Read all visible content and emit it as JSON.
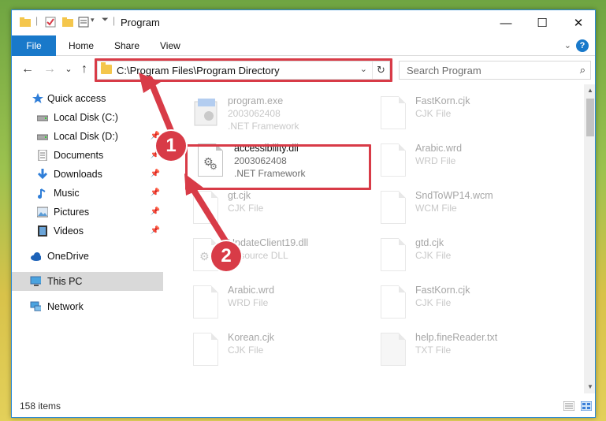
{
  "window": {
    "title": "Program",
    "min_glyph": "—",
    "max_glyph": "☐",
    "close_glyph": "✕"
  },
  "ribbon": {
    "tabs": [
      "File",
      "Home",
      "Share",
      "View"
    ],
    "help": "?",
    "collapse_glyph": "⌄"
  },
  "address": {
    "path": "C:\\Program Files\\Program Directory",
    "dropdown_glyph": "⌄",
    "refresh_glyph": "↻",
    "back_glyph": "←",
    "forward_glyph": "→",
    "recent_glyph": "⌄",
    "up_glyph": "↑"
  },
  "search": {
    "placeholder": "Search Program",
    "icon": "search-icon"
  },
  "sidebar": {
    "items": [
      {
        "label": "Quick access",
        "icon": "star-icon"
      },
      {
        "label": "Local Disk (C:)",
        "icon": "drive-icon"
      },
      {
        "label": "Local Disk (D:)",
        "icon": "drive-icon"
      },
      {
        "label": "Documents",
        "icon": "documents-icon"
      },
      {
        "label": "Downloads",
        "icon": "download-icon"
      },
      {
        "label": "Music",
        "icon": "music-icon"
      },
      {
        "label": "Pictures",
        "icon": "pictures-icon"
      },
      {
        "label": "Videos",
        "icon": "videos-icon"
      },
      {
        "label": "OneDrive",
        "icon": "cloud-icon"
      },
      {
        "label": "This PC",
        "icon": "pc-icon"
      },
      {
        "label": "Network",
        "icon": "network-icon"
      }
    ]
  },
  "files": {
    "left": [
      {
        "name": "program.exe",
        "line2": "2003062408",
        "line3": ".NET Framework"
      },
      {
        "name": "accessibility.dll",
        "line2": "2003062408",
        "line3": ".NET Framework"
      },
      {
        "name": "gt.cjk",
        "line2": "CJK File",
        "line3": ""
      },
      {
        "name": "UpdateClient19.dll",
        "line2": "Resource DLL",
        "line3": ""
      },
      {
        "name": "Arabic.wrd",
        "line2": "WRD File",
        "line3": ""
      },
      {
        "name": "Korean.cjk",
        "line2": "CJK File",
        "line3": ""
      }
    ],
    "right": [
      {
        "name": "FastKorn.cjk",
        "line2": "CJK File"
      },
      {
        "name": "Arabic.wrd",
        "line2": "WRD File"
      },
      {
        "name": "SndToWP14.wcm",
        "line2": "WCM File"
      },
      {
        "name": "gtd.cjk",
        "line2": "CJK File"
      },
      {
        "name": "FastKorn.cjk",
        "line2": "CJK File"
      },
      {
        "name": "help.fineReader.txt",
        "line2": "TXT File"
      }
    ]
  },
  "status": {
    "count": "158 items"
  },
  "callouts": [
    "1",
    "2"
  ],
  "colors": {
    "accent": "#1979ca",
    "highlight": "#d83b47",
    "folder": "#f4c64c"
  }
}
